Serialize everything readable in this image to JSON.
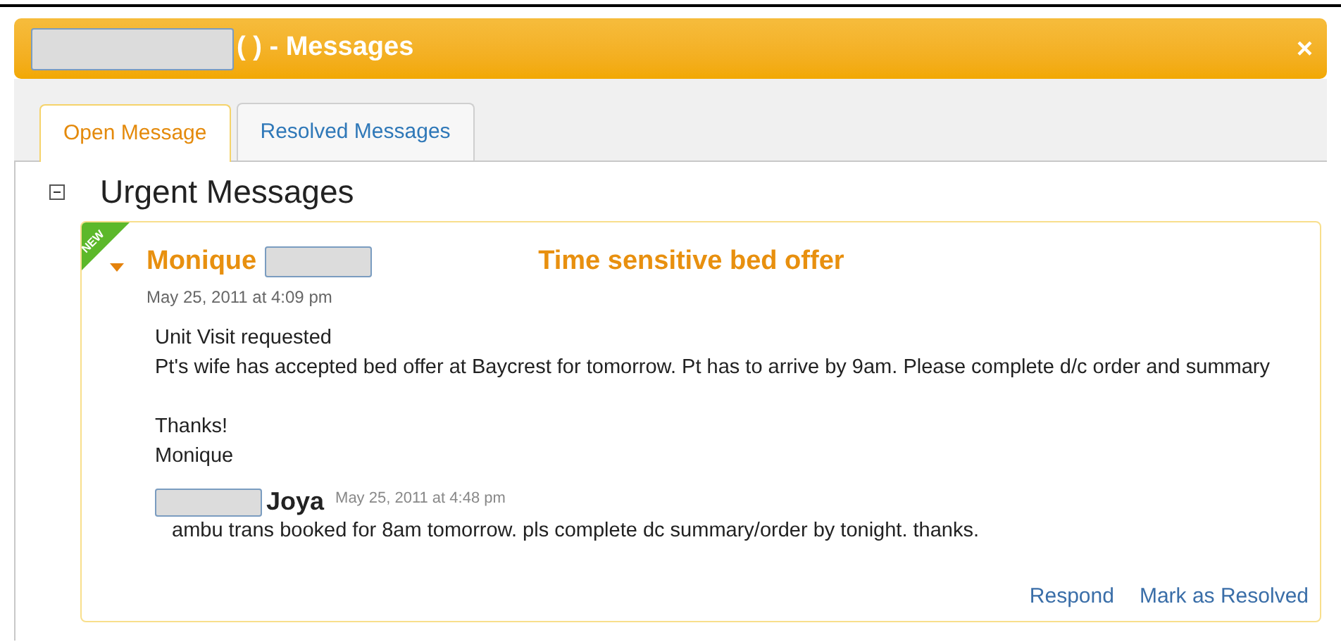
{
  "window": {
    "title": "( ) - Messages",
    "close": "×"
  },
  "tabs": [
    {
      "label": "Open Message",
      "selected": true
    },
    {
      "label": "Resolved Messages",
      "selected": false
    }
  ],
  "section": {
    "title": "Urgent Messages",
    "expanded": true
  },
  "message": {
    "badge": "NEW",
    "expanded": true,
    "sender": "Monique",
    "subject": "Time sensitive bed offer",
    "time": "May 25, 2011 at 4:09 pm",
    "paragraphs": [
      [
        "Unit Visit requested",
        "Pt's wife has accepted bed offer at Baycrest for tomorrow. Pt has to arrive by 9am. Please complete d/c order and summary"
      ],
      [
        "Thanks!",
        "Monique"
      ]
    ],
    "reply": {
      "sender": "Joya",
      "time": "May 25, 2011 at 4:48 pm",
      "text": "ambu trans booked for 8am tomorrow. pls complete dc summary/order by tonight. thanks."
    },
    "actions": [
      "Respond",
      "Mark as Resolved"
    ]
  }
}
